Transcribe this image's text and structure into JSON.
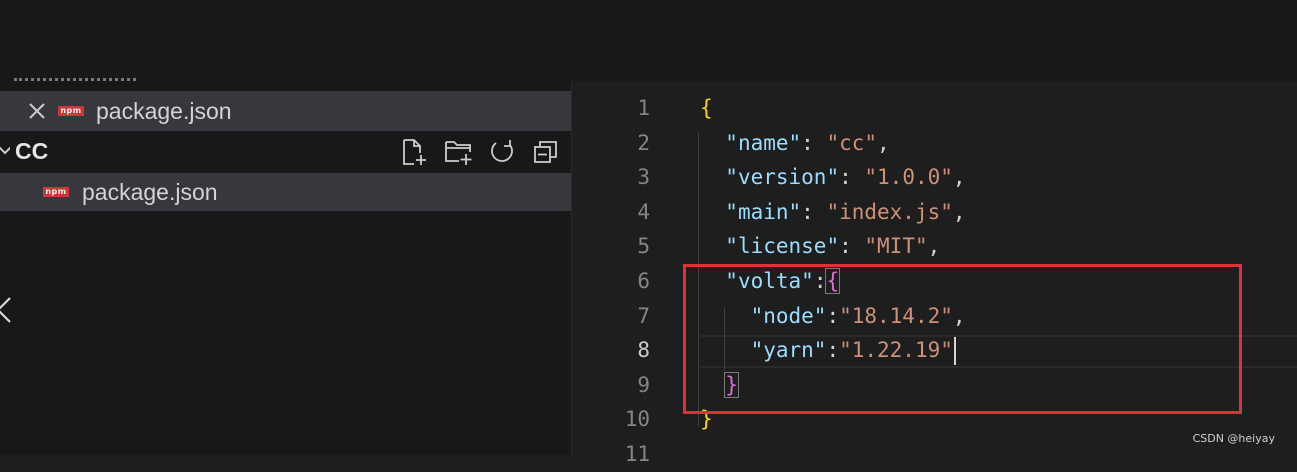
{
  "sidebar": {
    "open_editors": [
      {
        "label": "package.json",
        "icon": "npm-icon",
        "close_icon": "close-icon"
      }
    ],
    "folder": {
      "name": "CC",
      "expanded": true,
      "actions": [
        {
          "name": "new-file-icon"
        },
        {
          "name": "new-folder-icon"
        },
        {
          "name": "refresh-icon"
        },
        {
          "name": "collapse-all-icon"
        }
      ]
    },
    "files": [
      {
        "label": "package.json",
        "icon": "npm-icon",
        "selected": true
      }
    ],
    "npm_badge": "npm"
  },
  "editor": {
    "active_line": 8,
    "lines": [
      {
        "n": "1",
        "tokens": [
          {
            "t": "{",
            "c": "br1"
          }
        ]
      },
      {
        "n": "2",
        "tokens": [
          {
            "t": "  "
          },
          {
            "t": "\"name\"",
            "c": "key"
          },
          {
            "t": ": "
          },
          {
            "t": "\"cc\"",
            "c": "str"
          },
          {
            "t": ","
          }
        ]
      },
      {
        "n": "3",
        "tokens": [
          {
            "t": "  "
          },
          {
            "t": "\"version\"",
            "c": "key"
          },
          {
            "t": ": "
          },
          {
            "t": "\"1.0.0\"",
            "c": "str"
          },
          {
            "t": ","
          }
        ]
      },
      {
        "n": "4",
        "tokens": [
          {
            "t": "  "
          },
          {
            "t": "\"main\"",
            "c": "key"
          },
          {
            "t": ": "
          },
          {
            "t": "\"index.js\"",
            "c": "str"
          },
          {
            "t": ","
          }
        ]
      },
      {
        "n": "5",
        "tokens": [
          {
            "t": "  "
          },
          {
            "t": "\"license\"",
            "c": "key"
          },
          {
            "t": ": "
          },
          {
            "t": "\"MIT\"",
            "c": "str"
          },
          {
            "t": ","
          }
        ]
      },
      {
        "n": "6",
        "tokens": [
          {
            "t": "  "
          },
          {
            "t": "\"volta\"",
            "c": "key"
          },
          {
            "t": ":"
          },
          {
            "t": "{",
            "c": "br2",
            "boxed": true
          }
        ]
      },
      {
        "n": "7",
        "tokens": [
          {
            "t": "    "
          },
          {
            "t": "\"node\"",
            "c": "key"
          },
          {
            "t": ":"
          },
          {
            "t": "\"18.14.2\"",
            "c": "str"
          },
          {
            "t": ","
          }
        ]
      },
      {
        "n": "8",
        "tokens": [
          {
            "t": "    "
          },
          {
            "t": "\"yarn\"",
            "c": "key"
          },
          {
            "t": ":"
          },
          {
            "t": "\"1.22.19\"",
            "c": "str"
          },
          {
            "t": "",
            "caret": true
          }
        ]
      },
      {
        "n": "9",
        "tokens": [
          {
            "t": "  "
          },
          {
            "t": "}",
            "c": "br2",
            "boxed": true
          }
        ]
      },
      {
        "n": "10",
        "tokens": [
          {
            "t": "}",
            "c": "br1"
          }
        ]
      },
      {
        "n": "11",
        "tokens": []
      }
    ]
  },
  "watermark": "CSDN @heiyay",
  "colors": {
    "highlight_box": "#e0303a",
    "key": "#9cdcfe",
    "string": "#ce9178",
    "bracket_level1": "#ffd700",
    "bracket_level2": "#da70d6"
  }
}
